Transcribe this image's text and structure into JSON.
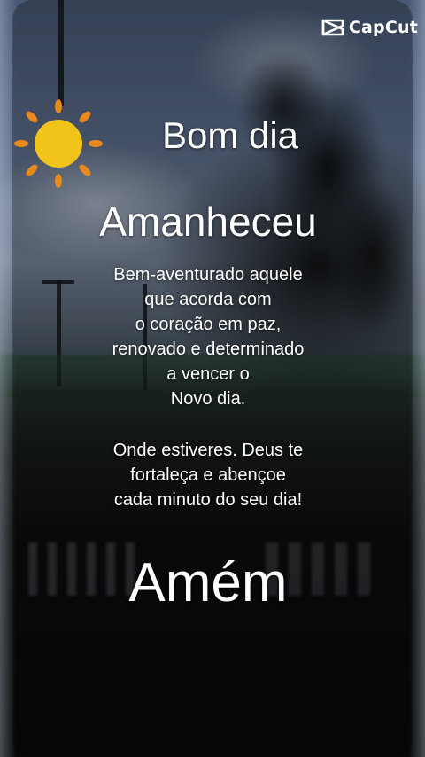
{
  "brand": {
    "name": "CapCut",
    "icon": "capcut-logo-icon"
  },
  "greeting": "Bom dia",
  "headline": "Amanheceu",
  "message": [
    "Bem-aventurado aquele",
    "que acorda com",
    "o coração em paz,",
    "renovado e determinado",
    "a vencer o",
    "Novo dia."
  ],
  "blessing": [
    "Onde estiveres. Deus te",
    "fortaleça e abençoe",
    "cada minuto do seu dia!"
  ],
  "closing": "Amém",
  "colors": {
    "sun": "#F2C318",
    "sun_rays": "#E8891C",
    "text": "#FFFFFF"
  },
  "icons": {
    "sun": "sun-icon"
  }
}
